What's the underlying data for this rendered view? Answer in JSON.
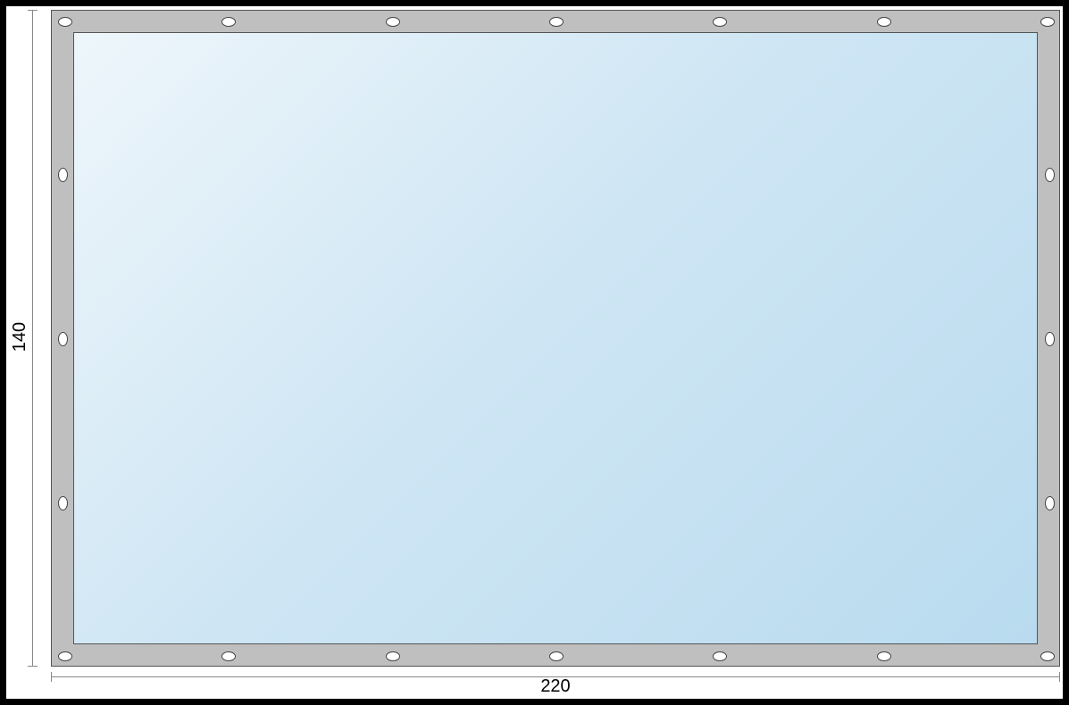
{
  "dimensions": {
    "height_label": "140",
    "width_label": "220"
  },
  "colors": {
    "frame": "#000000",
    "hem": "#bfbfbf",
    "window_light": "#eef6fb",
    "window_dark": "#b9dbef",
    "grommet_fill": "#ffffff",
    "grommet_stroke": "#444444"
  },
  "grommets": {
    "top_count": 7,
    "bottom_count": 7,
    "left_count": 3,
    "right_count": 3
  }
}
